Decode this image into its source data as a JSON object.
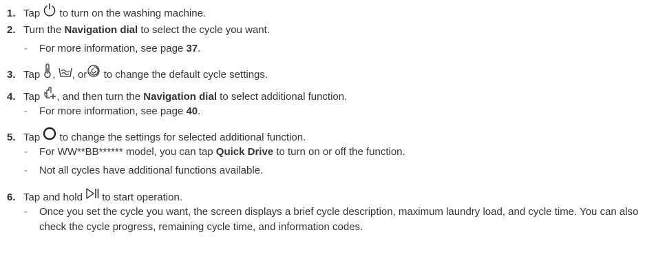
{
  "steps": [
    {
      "num": "1.",
      "before": "Tap",
      "icon": "power-icon",
      "after": "to turn on the washing machine."
    },
    {
      "num": "2.",
      "before": "Turn the",
      "bold": "Navigation dial",
      "after": "to select the cycle you want.",
      "notes": [
        {
          "text": "For more information, see page",
          "bold": "37",
          "end": "."
        }
      ]
    },
    {
      "num": "3.",
      "before": "Tap",
      "icons": [
        "temperature-icon",
        "rinse-icon",
        "spin-icon"
      ],
      "sep1": ",",
      "sep2": ", or",
      "after": "to change the default cycle settings."
    },
    {
      "num": "4.",
      "before": "Tap",
      "icon": "additional-function-icon",
      "mid": ", and then turn the",
      "bold": "Navigation dial",
      "after": "to select additional function.",
      "notes": [
        {
          "text": "For more information, see page",
          "bold": "40",
          "end": "."
        }
      ]
    },
    {
      "num": "5.",
      "before": "Tap",
      "icon": "circle-select-icon",
      "after": "to change the settings for selected additional function.",
      "notes": [
        {
          "text": "For WW**BB****** model, you can tap",
          "bold": "Quick Drive",
          "end": "to turn on or off the function."
        },
        {
          "text": "Not all cycles have additional functions available."
        }
      ]
    },
    {
      "num": "6.",
      "before": "Tap and hold",
      "icon": "start-pause-icon",
      "after": "to start operation.",
      "notes": [
        {
          "text": "Once you set the cycle you want, the screen displays a brief cycle description, maximum laundry load, and cycle time. You can also check the cycle progress, remaining cycle time, and information codes."
        }
      ]
    }
  ],
  "colors": {
    "text": "#333333",
    "dash": "#777777"
  }
}
